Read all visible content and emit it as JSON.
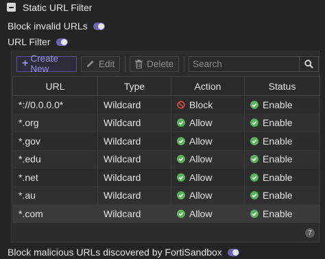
{
  "section": {
    "title": "Static URL Filter"
  },
  "toggles": {
    "block_invalid": {
      "label": "Block invalid URLs",
      "on": true
    },
    "url_filter": {
      "label": "URL Filter",
      "on": true
    },
    "fortisandbox": {
      "label": "Block malicious URLs discovered by FortiSandbox",
      "on": true
    }
  },
  "toolbar": {
    "create_label": "Create New",
    "edit_label": "Edit",
    "delete_label": "Delete",
    "search_placeholder": "Search"
  },
  "table": {
    "columns": [
      "URL",
      "Type",
      "Action",
      "Status"
    ],
    "rows": [
      {
        "url": "*://0.0.0.0*",
        "type": "Wildcard",
        "action": "Block",
        "status": "Enable"
      },
      {
        "url": "*.org",
        "type": "Wildcard",
        "action": "Allow",
        "status": "Enable"
      },
      {
        "url": "*.gov",
        "type": "Wildcard",
        "action": "Allow",
        "status": "Enable"
      },
      {
        "url": "*.edu",
        "type": "Wildcard",
        "action": "Allow",
        "status": "Enable"
      },
      {
        "url": "*.net",
        "type": "Wildcard",
        "action": "Allow",
        "status": "Enable"
      },
      {
        "url": "*.au",
        "type": "Wildcard",
        "action": "Allow",
        "status": "Enable"
      },
      {
        "url": "*.com",
        "type": "Wildcard",
        "action": "Allow",
        "status": "Enable"
      }
    ],
    "count": "7"
  },
  "colors": {
    "accent": "#6c64b3",
    "allow": "#59b25a",
    "block": "#e04848"
  }
}
